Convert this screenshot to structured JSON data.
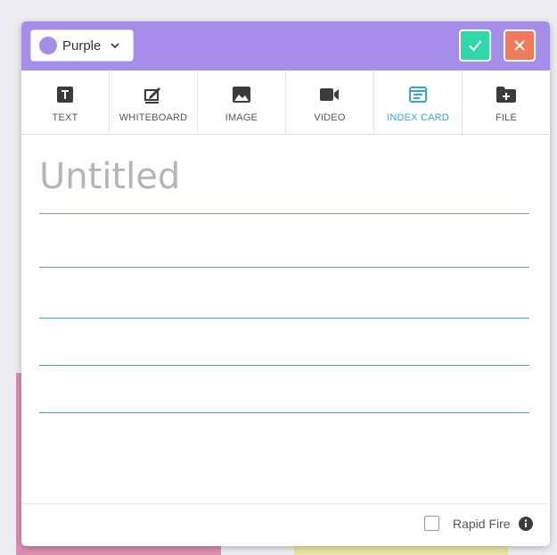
{
  "colors": {
    "header_bg": "#a48ee9",
    "selected_color": "#a48ee9",
    "confirm_bg": "#2fd8a6",
    "cancel_bg": "#ef7a5c",
    "active_tab": "#3aa3d8",
    "title_rule": "#e07a6a",
    "line_rule": "#4a9be0"
  },
  "header": {
    "color_select": {
      "label": "Purple",
      "icon": "chevron-down-icon"
    },
    "confirm_icon": "check-icon",
    "cancel_icon": "close-icon"
  },
  "tabs": [
    {
      "label": "TEXT",
      "icon": "text-icon",
      "active": false
    },
    {
      "label": "WHITEBOARD",
      "icon": "whiteboard-icon",
      "active": false
    },
    {
      "label": "IMAGE",
      "icon": "image-icon",
      "active": false
    },
    {
      "label": "VIDEO",
      "icon": "video-icon",
      "active": false
    },
    {
      "label": "INDEX CARD",
      "icon": "index-card-icon",
      "active": true
    },
    {
      "label": "FILE",
      "icon": "file-add-icon",
      "active": false
    }
  ],
  "card": {
    "title_placeholder": "Untitled"
  },
  "footer": {
    "rapid_fire_label": "Rapid Fire",
    "rapid_fire_checked": false,
    "info_icon": "info-icon"
  }
}
